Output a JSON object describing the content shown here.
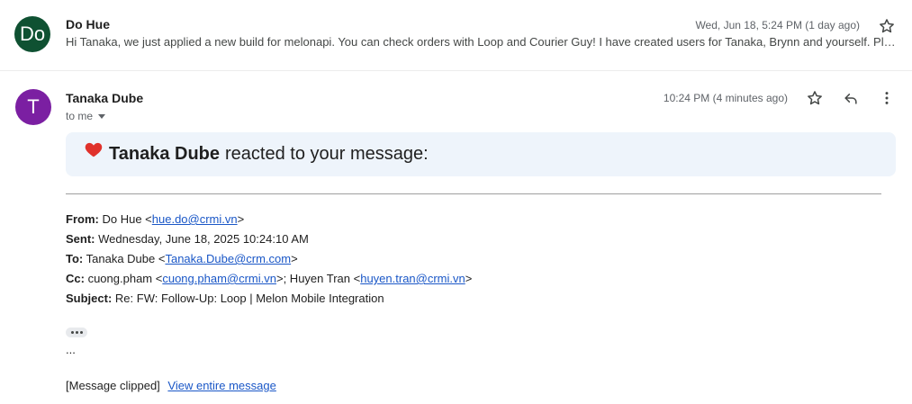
{
  "message1": {
    "avatar_initials": "Do",
    "avatar_color": "#0f5132",
    "sender": "Do Hue",
    "snippet": "Hi Tanaka, we just applied a new build for melonapi. You can check orders with Loop and Courier Guy! I have created users for Tanaka, Brynn and yourself. Pl…",
    "date": "Wed, Jun 18, 5:24 PM (1 day ago)"
  },
  "message2": {
    "avatar_initials": "T",
    "avatar_color": "#7b1fa2",
    "sender": "Tanaka Dube",
    "date": "10:24 PM (4 minutes ago)",
    "to": "to me"
  },
  "reaction": {
    "emoji": "heart",
    "name": "Tanaka Dube",
    "text": "reacted to your message:"
  },
  "headers": {
    "from_label": "From:",
    "from_name": "Do Hue <",
    "from_email": "hue.do@crmi.vn",
    "from_close": ">",
    "sent_label": "Sent:",
    "sent_value": "Wednesday, June 18, 2025 10:24:10 AM",
    "to_label": "To:",
    "to_name": "Tanaka Dube <",
    "to_email": "Tanaka.Dube@crm.com",
    "to_close": ">",
    "cc_label": "Cc:",
    "cc_name1": "cuong.pham <",
    "cc_email1": "cuong.pham@crmi.vn",
    "cc_mid": ">; Huyen Tran <",
    "cc_email2": "huyen.tran@crmi.vn",
    "cc_close": ">",
    "subject_label": "Subject:",
    "subject_value": "Re: FW: Follow-Up: Loop | Melon Mobile Integration"
  },
  "ellipsis": "...",
  "clipped_text": "[Message clipped]",
  "view_entire": "View entire message",
  "colors": {
    "link": "#1a57c7",
    "reaction_bg": "#eef4fb"
  }
}
